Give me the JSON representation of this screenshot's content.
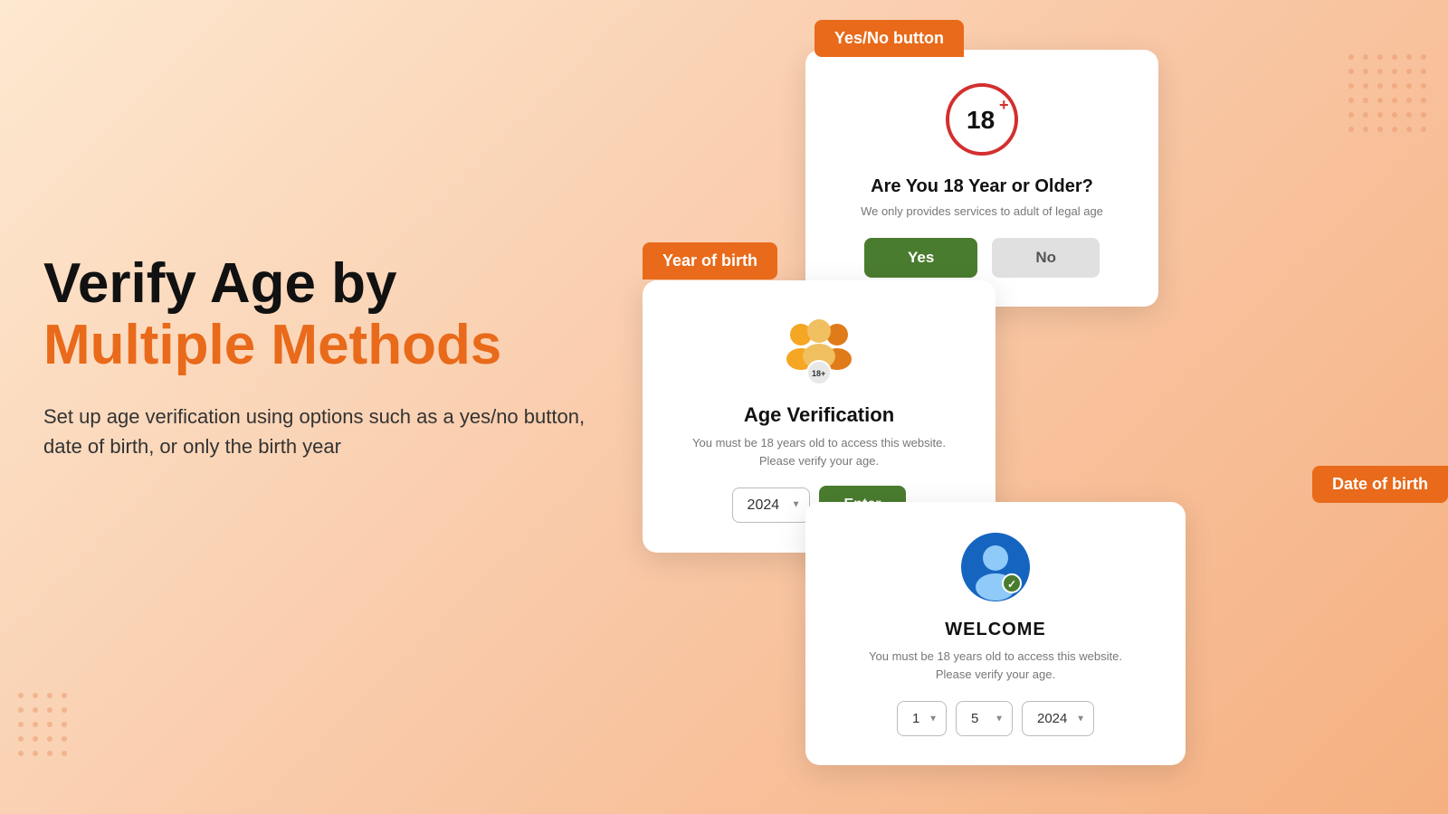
{
  "page": {
    "background": "#fde8d0"
  },
  "hero": {
    "title_part1": "Verify Age by ",
    "title_part2": "Multiple Methods",
    "subtitle": "Set up age verification using options such as a yes/no button, date of birth, or only the birth year"
  },
  "label_tabs": {
    "yes_no": "Yes/No button",
    "year_of_birth": "Year of birth",
    "date_of_birth": "Date of birth"
  },
  "yes_no_card": {
    "title": "Are You 18 Year or Older?",
    "subtitle": "We only provides services to adult of legal age",
    "yes_label": "Yes",
    "no_label": "No"
  },
  "year_card": {
    "title": "Age Verification",
    "subtitle": "You must be 18 years old to access this website.\nPlease verify your age.",
    "year_value": "2024",
    "enter_label": "Enter"
  },
  "dob_card": {
    "title": "WELCOME",
    "subtitle": "You must be 18 years old to access this website.\nPlease verify your age.",
    "day_value": "1",
    "month_value": "5",
    "year_value": "2024"
  }
}
